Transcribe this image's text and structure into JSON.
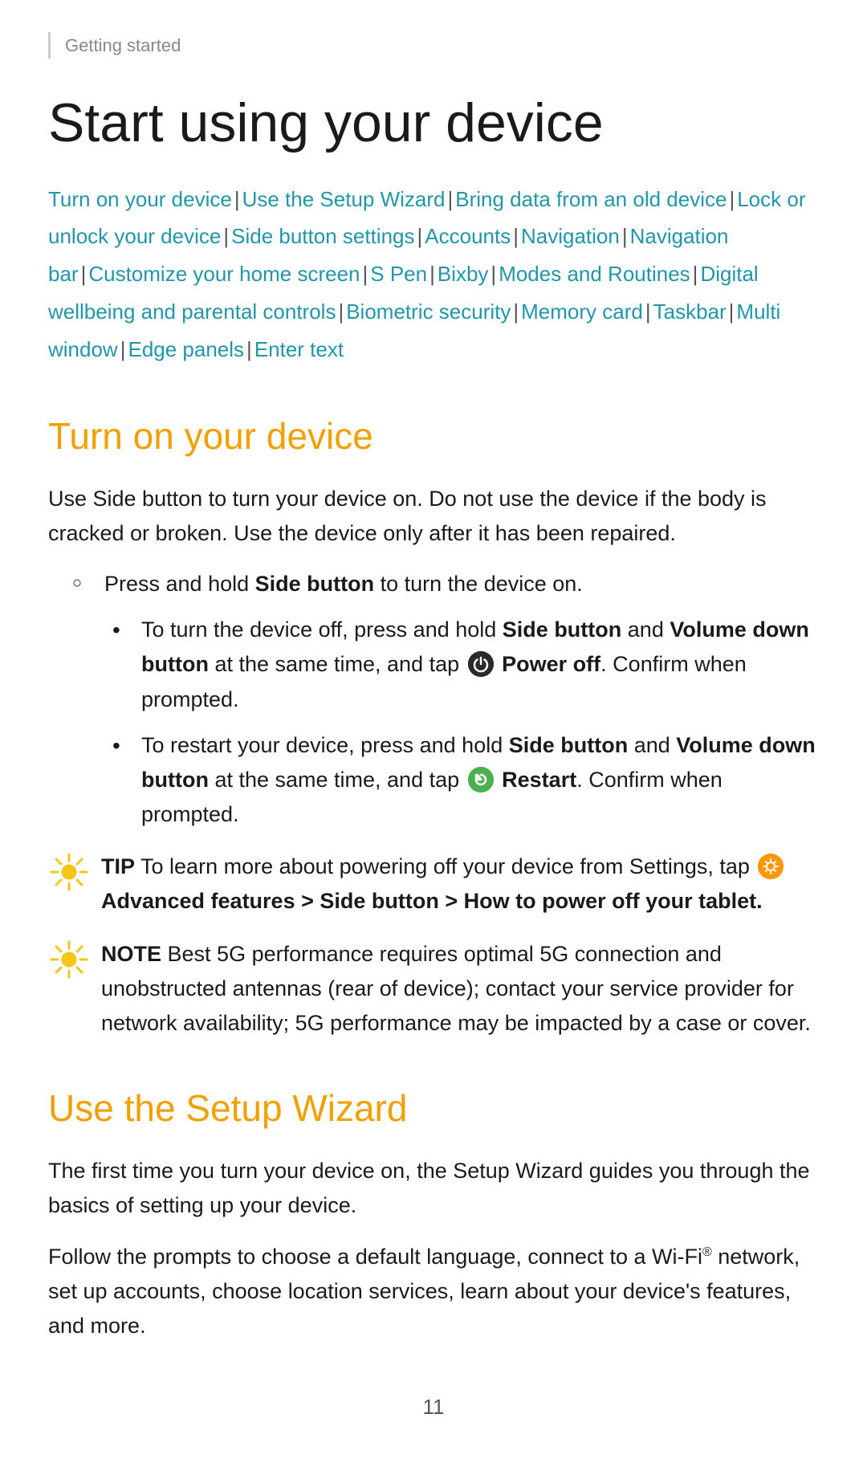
{
  "breadcrumb": "Getting started",
  "page_title": "Start using your device",
  "toc": {
    "items": [
      {
        "label": "Turn on your device",
        "id": "turn-on"
      },
      {
        "label": "Use the Setup Wizard",
        "id": "setup-wizard"
      },
      {
        "label": "Bring data from an old device",
        "id": "bring-data"
      },
      {
        "label": "Lock or unlock your device",
        "id": "lock-unlock"
      },
      {
        "label": "Side button settings",
        "id": "side-button"
      },
      {
        "label": "Accounts",
        "id": "accounts"
      },
      {
        "label": "Navigation",
        "id": "navigation"
      },
      {
        "label": "Navigation bar",
        "id": "navigation-bar"
      },
      {
        "label": "Customize your home screen",
        "id": "customize"
      },
      {
        "label": "S Pen",
        "id": "s-pen"
      },
      {
        "label": "Bixby",
        "id": "bixby"
      },
      {
        "label": "Modes and Routines",
        "id": "modes-routines"
      },
      {
        "label": "Digital wellbeing and parental controls",
        "id": "digital-wellbeing"
      },
      {
        "label": "Biometric security",
        "id": "biometric"
      },
      {
        "label": "Memory card",
        "id": "memory-card"
      },
      {
        "label": "Taskbar",
        "id": "taskbar"
      },
      {
        "label": "Multi window",
        "id": "multi-window"
      },
      {
        "label": "Edge panels",
        "id": "edge-panels"
      },
      {
        "label": "Enter text",
        "id": "enter-text"
      }
    ]
  },
  "section1": {
    "title": "Turn on your device",
    "intro": "Use Side button to turn your device on. Do not use the device if the body is cracked or broken. Use the device only after it has been repaired.",
    "bullet_main": "Press and hold Side button to turn the device on.",
    "sub_bullets": [
      "To turn the device off, press and hold Side button and Volume down button at the same time, and tap  Power off. Confirm when prompted.",
      "To restart your device, press and hold Side button and Volume down button at the same time, and tap  Restart. Confirm when prompted."
    ],
    "tip_label": "TIP",
    "tip_text": "To learn more about powering off your device from Settings, tap  Advanced features > Side button > How to power off your tablet.",
    "note_label": "NOTE",
    "note_text": "Best 5G performance requires optimal 5G connection and unobstructed antennas (rear of device); contact your service provider for network availability; 5G performance may be impacted by a case or cover."
  },
  "section2": {
    "title": "Use the Setup Wizard",
    "para1": "The first time you turn your device on, the Setup Wizard guides you through the basics of setting up your device.",
    "para2": "Follow the prompts to choose a default language, connect to a Wi-Fi® network, set up accounts, choose location services, learn about your device's features, and more."
  },
  "page_number": "11"
}
